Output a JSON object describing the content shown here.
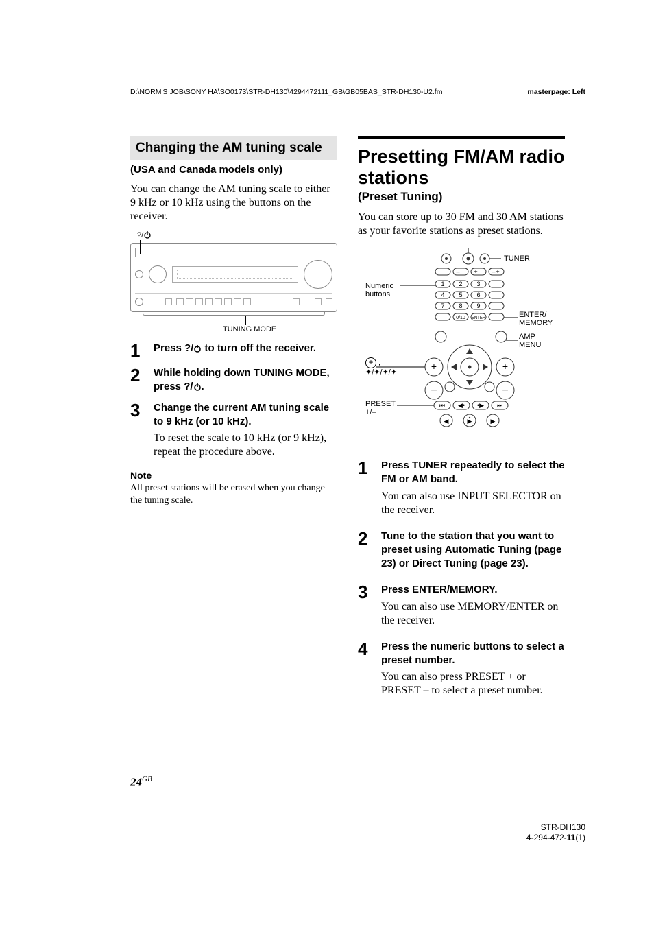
{
  "header": {
    "path": "D:\\NORM'S JOB\\SONY HA\\SO0173\\STR-DH130\\4294472111_GB\\GB05BAS_STR-DH130-U2.fm",
    "master": "masterpage: Left"
  },
  "left": {
    "bar_title": "Changing the AM tuning scale",
    "subhead": "(USA and Canada models only)",
    "intro": "You can change the AM tuning scale to either 9 kHz or 10 kHz using the buttons on the receiver.",
    "diagram": {
      "power_label_prefix": "?/",
      "tuning_mode_label": "TUNING MODE"
    },
    "steps": [
      {
        "n": "1",
        "strong_pre": "Press ",
        "strong_mid": "?/",
        "strong_post": " to turn off the receiver."
      },
      {
        "n": "2",
        "strong_pre": "While holding down TUNING MODE, press ",
        "strong_mid": "?/",
        "strong_post": "."
      },
      {
        "n": "3",
        "strong_pre": "Change the current AM tuning scale to 9 kHz (or 10 kHz).",
        "strong_mid": "",
        "strong_post": "",
        "after": "To reset the scale to 10 kHz (or 9 kHz), repeat the procedure above."
      }
    ],
    "note_head": "Note",
    "note_body": "All preset stations will be erased when you change the tuning scale."
  },
  "right": {
    "h1": "Presetting FM/AM radio stations",
    "h2": "(Preset Tuning)",
    "intro": "You can store up to 30 FM and 30 AM stations as your favorite stations as preset stations.",
    "diagram_labels": {
      "numeric": "Numeric buttons",
      "tuner": "TUNER",
      "enter_memory": "ENTER/\nMEMORY",
      "amp_menu": "AMP MENU",
      "plus_arrows": ",",
      "preset": "PRESET +/–"
    },
    "steps": [
      {
        "n": "1",
        "strong": "Press TUNER repeatedly to select the FM or AM band.",
        "after": "You can also use INPUT SELECTOR on the receiver."
      },
      {
        "n": "2",
        "strong": "Tune to the station that you want to preset using Automatic Tuning (page 23) or Direct Tuning (page 23)."
      },
      {
        "n": "3",
        "strong": "Press ENTER/MEMORY.",
        "after": "You can also use MEMORY/ENTER on the receiver."
      },
      {
        "n": "4",
        "strong": "Press the numeric buttons to select a preset number.",
        "after": "You can also press PRESET + or PRESET – to select a preset number."
      }
    ]
  },
  "footer": {
    "page_num": "24",
    "gb": "GB",
    "model": "STR-DH130",
    "docnum": "4-294-472-11(1)"
  }
}
